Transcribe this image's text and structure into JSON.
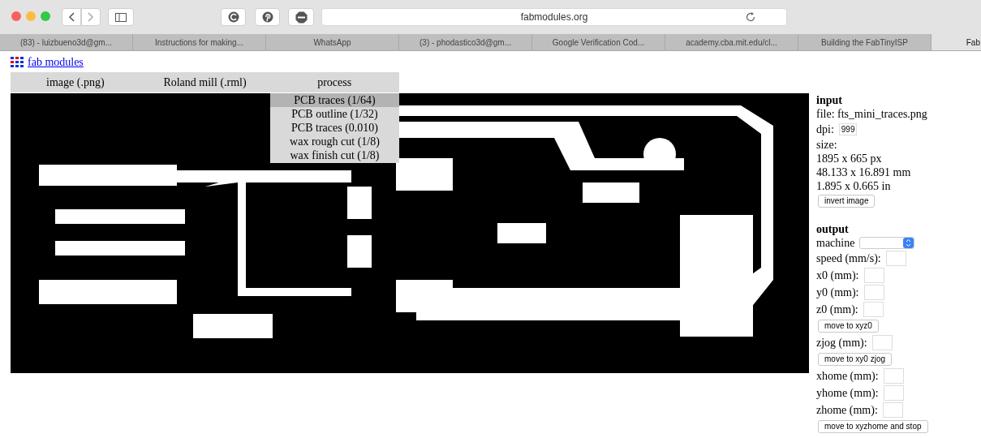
{
  "browser": {
    "address": "fabmodules.org",
    "tabs": [
      {
        "label": "(83) - luizbueno3d@gm...",
        "selected": false
      },
      {
        "label": "Instructions for making...",
        "selected": false
      },
      {
        "label": "WhatsApp",
        "selected": false
      },
      {
        "label": "(3) - phodastico3d@gm...",
        "selected": false
      },
      {
        "label": "Google Verification Cod...",
        "selected": false
      },
      {
        "label": "academy.cba.mit.edu/cl...",
        "selected": false
      },
      {
        "label": "Building the FabTinyISP",
        "selected": false
      },
      {
        "label": "Fab",
        "selected": true
      }
    ]
  },
  "page": {
    "logo_link": "fab modules",
    "menu": [
      {
        "label": "image (.png)"
      },
      {
        "label": "Roland mill (.rml)"
      },
      {
        "label": "process"
      }
    ],
    "dropdown": [
      {
        "label": "PCB traces (1/64)",
        "selected": true
      },
      {
        "label": "PCB outline (1/32)",
        "selected": false
      },
      {
        "label": "PCB traces (0.010)",
        "selected": false
      },
      {
        "label": "wax rough cut (1/8)",
        "selected": false
      },
      {
        "label": "wax finish cut (1/8)",
        "selected": false
      }
    ],
    "input": {
      "heading": "input",
      "file": "file: fts_mini_traces.png",
      "dpi_label": "dpi:",
      "dpi_value": "999",
      "size_label": "size:",
      "size_lines": [
        "1895 x 665 px",
        "48.133 x 16.891 mm",
        "1.895 x 0.665 in"
      ],
      "button": "invert image"
    },
    "output": {
      "heading": "output",
      "items": [
        {
          "kind": "select",
          "label": "machine"
        },
        {
          "kind": "field",
          "label": "speed (mm/s):"
        },
        {
          "kind": "field",
          "label": "x0 (mm):"
        },
        {
          "kind": "field",
          "label": "y0 (mm):"
        },
        {
          "kind": "field",
          "label": "z0 (mm):"
        },
        {
          "kind": "button",
          "label": "move to xyz0"
        },
        {
          "kind": "field",
          "label": "zjog (mm):"
        },
        {
          "kind": "button",
          "label": "move to xy0 zjog"
        },
        {
          "kind": "field",
          "label": "xhome (mm):"
        },
        {
          "kind": "field",
          "label": "yhome (mm):"
        },
        {
          "kind": "field",
          "label": "zhome (mm):"
        },
        {
          "kind": "button",
          "label": "move to xyzhome and stop"
        }
      ]
    }
  }
}
